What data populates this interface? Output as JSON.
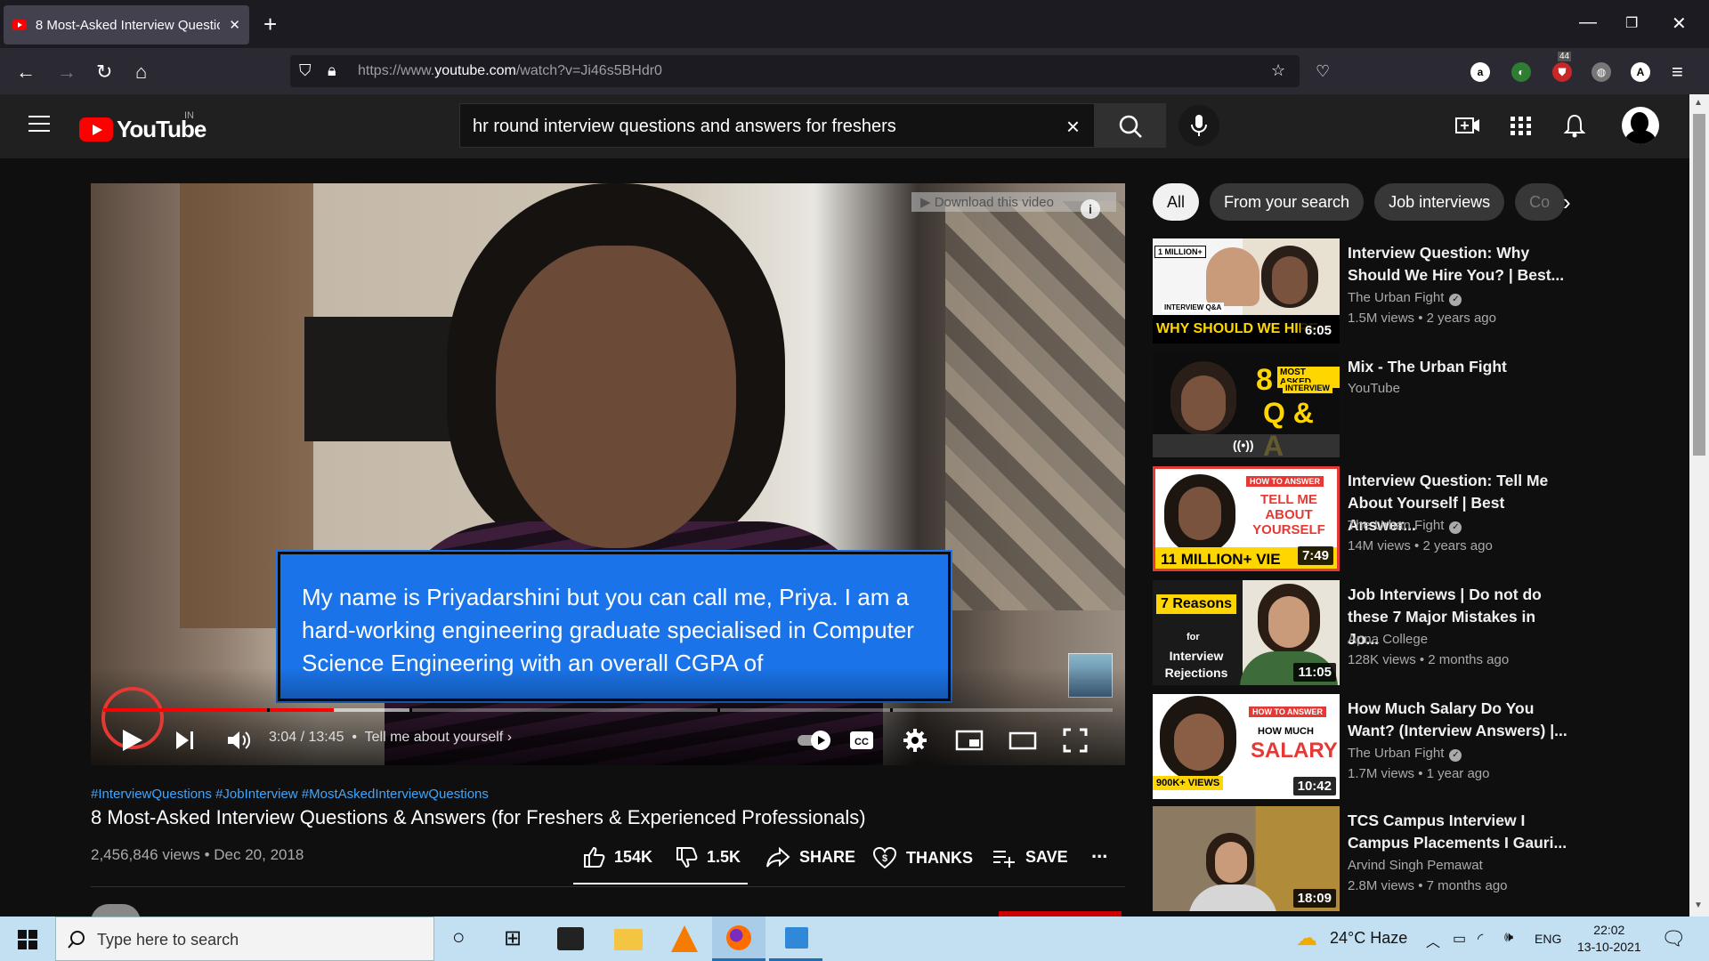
{
  "browser": {
    "tab_title": "8 Most-Asked Interview Questio",
    "url_prefix": "https://www.",
    "url_host": "youtube.com",
    "url_path": "/watch?v=Ji46s5BHdr0",
    "extension_badge": "44"
  },
  "youtube": {
    "logo": "YouTube",
    "country": "IN",
    "search_query": "hr round interview questions and answers for freshers"
  },
  "player": {
    "download_bar": "Download this video",
    "caption": "My name is Priyadarshini but you can call me, Priya. I am a hard-working engineering graduate specialised in Computer Science Engineering with an overall CGPA of",
    "time": "3:04 / 13:45",
    "chapter": "Tell me about yourself",
    "progress_played": 0.228,
    "progress_loaded": 0.305,
    "cc_label": "CC"
  },
  "video": {
    "hashtags": "#InterviewQuestions #JobInterview #MostAskedInterviewQuestions",
    "title": "8 Most-Asked Interview Questions & Answers (for Freshers & Experienced Professionals)",
    "meta": "2,456,846 views • Dec 20, 2018",
    "likes": "154K",
    "dislikes": "1.5K",
    "share": "SHARE",
    "thanks": "THANKS",
    "save": "SAVE",
    "more": "..."
  },
  "chips": [
    "All",
    "From your search",
    "Job interviews",
    "Co"
  ],
  "recommendations": [
    {
      "title": "Interview Question: Why Should We Hire You? | Best...",
      "channel": "The Urban Fight",
      "verified": true,
      "stats": "1.5M views • 2 years ago",
      "duration": "6:05",
      "thumb_text": "WHY SHOULD WE HIRE",
      "thumb_badge": "1 MILLION+",
      "thumb_sub": "INTERVIEW Q&A"
    },
    {
      "title": "Mix - The Urban Fight",
      "channel": "YouTube",
      "verified": false,
      "stats": "",
      "duration": "",
      "thumb_text": "Q & A",
      "thumb_badge": "MOST ASKED",
      "thumb_sub": "INTERVIEW"
    },
    {
      "title": "Interview Question: Tell Me About Yourself | Best Answer...",
      "channel": "The Urban Fight",
      "verified": true,
      "stats": "14M views • 2 years ago",
      "duration": "7:49",
      "thumb_text": "TELL ME ABOUT YOURSELF",
      "thumb_badge": "HOW TO ANSWER",
      "thumb_sub": "11 MILLION+ VIE"
    },
    {
      "title": "Job Interviews | Do not do these 7 Major Mistakes in Jo...",
      "channel": "Apna College",
      "verified": false,
      "stats": "128K views • 2 months ago",
      "duration": "11:05",
      "thumb_text": "7 Reasons",
      "thumb_badge": "for",
      "thumb_sub": "Interview Rejections"
    },
    {
      "title": "How Much Salary Do You Want? (Interview Answers) |...",
      "channel": "The Urban Fight",
      "verified": true,
      "stats": "1.7M views • 1 year ago",
      "duration": "10:42",
      "thumb_text": "SALARY",
      "thumb_badge": "HOW TO ANSWER",
      "thumb_sub": "900K+ VIEWS"
    },
    {
      "title": "TCS Campus Interview I Campus Placements I Gauri...",
      "channel": "Arvind Singh Pemawat",
      "verified": false,
      "stats": "2.8M views • 7 months ago",
      "duration": "18:09",
      "thumb_text": "",
      "thumb_badge": "",
      "thumb_sub": ""
    }
  ],
  "taskbar": {
    "search_placeholder": "Type here to search",
    "weather": "24°C  Haze",
    "lang": "ENG",
    "time": "22:02",
    "date": "13-10-2021"
  },
  "colors": {
    "accent_red": "#ff0000",
    "link_blue": "#3ea6ff",
    "caption_blue": "#1a73e8"
  }
}
